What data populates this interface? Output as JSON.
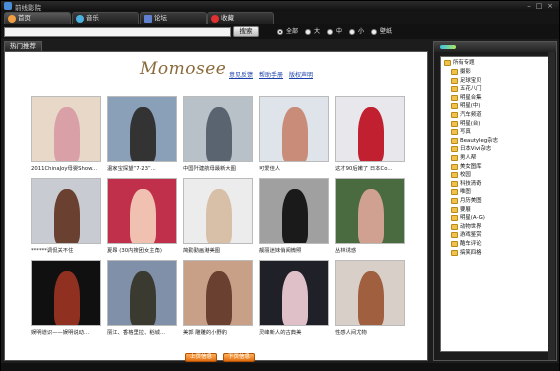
{
  "window": {
    "title": "前线影院"
  },
  "tabs": [
    {
      "label": "首页",
      "icon": "home-icon",
      "color": "#f0a040"
    },
    {
      "label": "音乐",
      "icon": "music-icon",
      "color": "#4ab0e0"
    },
    {
      "label": "论坛",
      "icon": "forum-icon",
      "color": "#6080d0"
    },
    {
      "label": "收藏",
      "icon": "heart-icon",
      "color": "#e03030"
    }
  ],
  "search": {
    "value": "",
    "button_label": "搜索",
    "options": [
      "全部",
      "大",
      "中",
      "小",
      "壁纸"
    ],
    "selected": "全部"
  },
  "main": {
    "panel_tab": "热门推荐",
    "logo": "Momosee",
    "links": [
      "意见反馈",
      "帮助手册",
      "版权声明"
    ],
    "grid": [
      {
        "caption": "2011ChinaJoy母婴Show...",
        "bg": "#e8d8c8",
        "fig": "#d9a0a8"
      },
      {
        "caption": "温家宝探望“7·23”...",
        "bg": "#8aa0b8",
        "fig": "#333333"
      },
      {
        "caption": "中国歼建航母最新大图",
        "bg": "#b8c0c8",
        "fig": "#5a6470"
      },
      {
        "caption": "可爱佳人",
        "bg": "#dfe4ea",
        "fig": "#c88c78"
      },
      {
        "caption": "这才90后嫩了 日本Co...",
        "bg": "#e8e8ec",
        "fig": "#c02030"
      },
      {
        "caption": "******调侃关不住",
        "bg": "#c8ccd2",
        "fig": "#6a4030"
      },
      {
        "caption": "夏昂 (30内搜团女主角)",
        "bg": "#c0304a",
        "fig": "#f0c0b0"
      },
      {
        "caption": "简勤勤画港美图",
        "bg": "#ececec",
        "fig": "#d8c0a8"
      },
      {
        "caption": "靓丽迷妹俏阅微照",
        "bg": "#a0a0a0",
        "fig": "#1a1a1a"
      },
      {
        "caption": "丛林诱惑",
        "bg": "#4a6a40",
        "fig": "#d0a090"
      },
      {
        "caption": "娱明道识——娱明说动...",
        "bg": "#101010",
        "fig": "#903020"
      },
      {
        "caption": "丽江、香格里拉、稻城...",
        "bg": "#8090a8",
        "fig": "#3a3a30"
      },
      {
        "caption": "美郭 雕雕的小野豹",
        "bg": "#c8a088",
        "fig": "#6a4030"
      },
      {
        "caption": "灵峰新人的古典美",
        "bg": "#202028",
        "fig": "#e0c0c8"
      },
      {
        "caption": "性感人间尤物",
        "bg": "#d8d0c8",
        "fig": "#a06040"
      }
    ],
    "prev_page": "上页信息",
    "next_page": "下页信息"
  },
  "sidebar": {
    "root": "所有专题",
    "items": [
      "摄影",
      "足球宝贝",
      "五花八门",
      "明星合集",
      "明星(中)",
      "汽车频道",
      "明星(台)",
      "写真",
      "Beautyleg杂志",
      "日本Vivi杂志",
      "男人帮",
      "美女图库",
      "校园",
      "科技清奇",
      "唯图",
      "月历美图",
      "要展",
      "明星(A-G)",
      "动物世界",
      "游戏鉴赏",
      "酷车评论",
      "搞笑四格"
    ]
  },
  "colors": {
    "accent": "#f07a1a",
    "link": "#1b3fa8",
    "chrome": "#1c1c1c"
  }
}
